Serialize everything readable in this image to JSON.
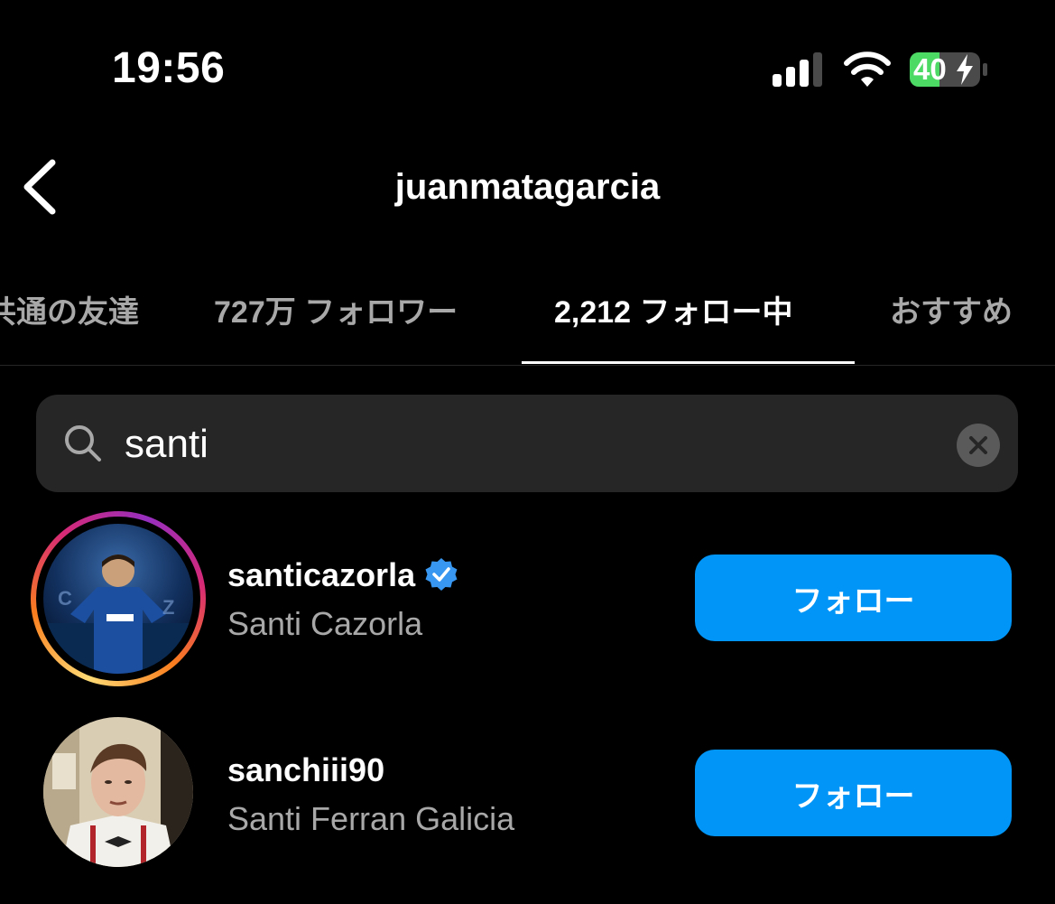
{
  "status_bar": {
    "time": "19:56",
    "battery_level": "40",
    "icons": [
      "cellular-signal-icon",
      "wifi-icon",
      "battery-charging-icon"
    ],
    "battery_color": "#4cd964"
  },
  "header": {
    "title": "juanmatagarcia",
    "back_icon": "chevron-left-icon"
  },
  "tabs": [
    {
      "label": "共通の友達",
      "active": false
    },
    {
      "label": "727万 フォロワー",
      "active": false
    },
    {
      "label": "2,212 フォロー中",
      "active": true
    },
    {
      "label": "おすすめ",
      "active": false
    }
  ],
  "search": {
    "value": "santi",
    "icon": "search-icon",
    "clear_icon": "clear-icon"
  },
  "results": [
    {
      "username": "santicazorla",
      "full_name": "Santi Cazorla",
      "verified": true,
      "has_story_ring": true,
      "button_label": "フォロー"
    },
    {
      "username": "sanchiii90",
      "full_name": "Santi Ferran Galicia",
      "verified": false,
      "has_story_ring": false,
      "button_label": "フォロー"
    }
  ],
  "colors": {
    "background": "#000000",
    "accent": "#0095f6",
    "secondary_text": "#a8a8a8",
    "search_bg": "#262626",
    "verified_badge": "#3897f0"
  }
}
